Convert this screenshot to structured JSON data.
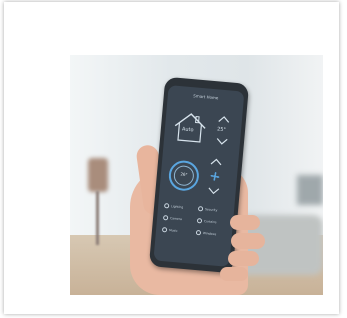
{
  "photo": {
    "subject": "hand holding smartphone with smart home control app",
    "colors": {
      "screen": "#3b4652",
      "accent": "#5aa6e0",
      "skin": "#e9b9a2",
      "wall": "#e2e8eb",
      "floor": "#c8b298"
    }
  },
  "app": {
    "title": "Smart Home",
    "house_label": "Auto",
    "temperature": "25°",
    "dial_value": "26°",
    "options": [
      "Lighting",
      "Security",
      "Camera",
      "Curtains",
      "Music",
      "Windows"
    ]
  }
}
